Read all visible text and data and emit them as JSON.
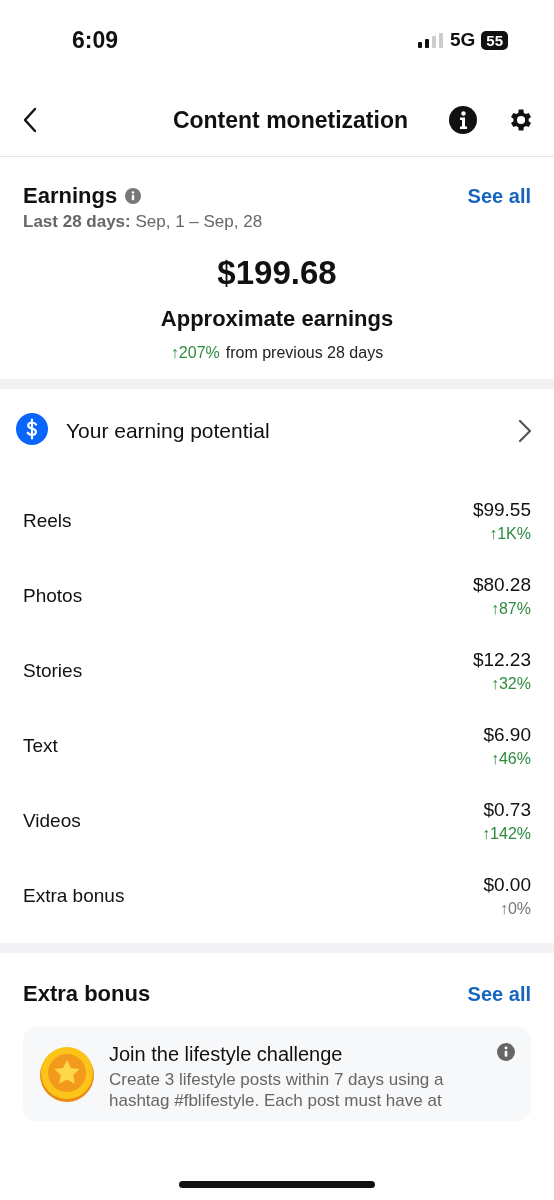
{
  "status_bar": {
    "time": "6:09",
    "network": "5G",
    "battery": "55"
  },
  "header": {
    "title": "Content monetization"
  },
  "earnings": {
    "title": "Earnings",
    "see_all": "See all",
    "period_label": "Last 28 days:",
    "period": "Sep, 1 – Sep, 28",
    "amount": "$199.68",
    "caption": "Approximate earnings",
    "change": "↑207%",
    "change_text": "from previous 28 days"
  },
  "potential": {
    "title": "Your earning potential"
  },
  "rows": [
    {
      "label": "Reels",
      "amount": "$99.55",
      "change": "↑1K%",
      "color": "#2e8b3e"
    },
    {
      "label": "Photos",
      "amount": "$80.28",
      "change": "↑87%",
      "color": "#2e8b3e"
    },
    {
      "label": "Stories",
      "amount": "$12.23",
      "change": "↑32%",
      "color": "#2e8b3e"
    },
    {
      "label": "Text",
      "amount": "$6.90",
      "change": "↑46%",
      "color": "#2e8b3e"
    },
    {
      "label": "Videos",
      "amount": "$0.73",
      "change": "↑142%",
      "color": "#2e8b3e"
    },
    {
      "label": "Extra bonus",
      "amount": "$0.00",
      "change": "↑0%",
      "color": "#777777"
    }
  ],
  "bonus": {
    "title": "Extra bonus",
    "see_all": "See all",
    "card": {
      "title": "Join the lifestyle challenge",
      "description": "Create 3 lifestyle posts within 7 days using a hashtag #fblifestyle. Each post must have at"
    }
  }
}
